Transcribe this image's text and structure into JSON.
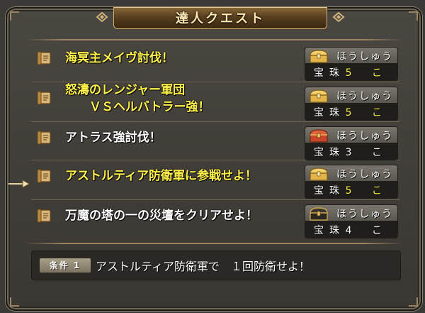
{
  "window": {
    "title": "達人クエスト"
  },
  "quests": [
    {
      "name": "海冥主メイヴ討伐！",
      "highlight": "yellow",
      "reward": {
        "label": "ほうしゅう",
        "item": "宝珠",
        "count": "5 こ",
        "count_highlight": "yellow",
        "chest": "gold-chest-icon"
      }
    },
    {
      "name": "怒濤のレンジャー軍団\n　　ＶＳヘルバトラー強！",
      "highlight": "yellow",
      "reward": {
        "label": "ほうしゅう",
        "item": "宝珠",
        "count": "5 こ",
        "count_highlight": "yellow",
        "chest": "gold-chest-icon"
      }
    },
    {
      "name": "アトラス強討伐！",
      "highlight": "white",
      "reward": {
        "label": "ほうしゅう",
        "item": "宝珠",
        "count": "3 こ",
        "count_highlight": "white",
        "chest": "red-chest-icon"
      }
    },
    {
      "name": "アストルティア防衛軍に参戦せよ！",
      "highlight": "yellow",
      "reward": {
        "label": "ほうしゅう",
        "item": "宝珠",
        "count": "5 こ",
        "count_highlight": "yellow",
        "chest": "gold-chest-icon"
      }
    },
    {
      "name": "万魔の塔の一の災壇をクリアせよ！",
      "highlight": "white",
      "reward": {
        "label": "ほうしゅう",
        "item": "宝珠",
        "count": "4 こ",
        "count_highlight": "white",
        "chest": "dark-chest-icon"
      }
    }
  ],
  "selected_index": 3,
  "condition": {
    "badge": "条件 1",
    "text": "アストルティア防衛軍で　１回防衛せよ！"
  },
  "colors": {
    "highlight_yellow": "#fff24a",
    "text_white": "#ffffff",
    "frame_gold": "#d4b070"
  }
}
